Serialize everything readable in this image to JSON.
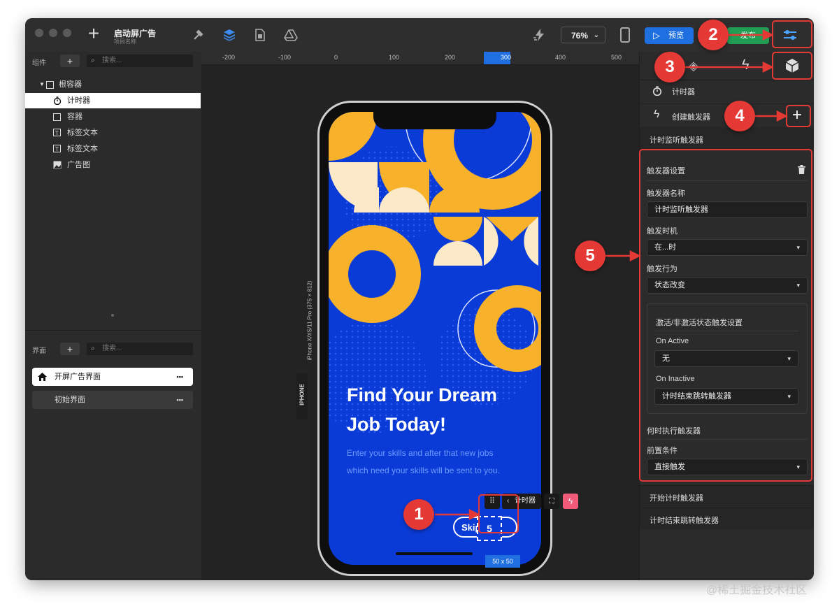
{
  "toolbar": {
    "project_title": "启动屏广告",
    "project_subtitle": "项目名称",
    "zoom": "76%",
    "preview_label": "预览",
    "publish_label": "发布"
  },
  "components_panel": {
    "header": "组件",
    "search_placeholder": "搜索...",
    "tree": [
      {
        "label": "根容器",
        "icon": "square-icon"
      },
      {
        "label": "计时器",
        "icon": "timer-icon"
      },
      {
        "label": "容器",
        "icon": "square-icon"
      },
      {
        "label": "标签文本",
        "icon": "text-icon"
      },
      {
        "label": "标签文本",
        "icon": "text-icon"
      },
      {
        "label": "广告图",
        "icon": "image-icon"
      }
    ]
  },
  "screens_panel": {
    "header": "界面",
    "search_placeholder": "搜索...",
    "screens": [
      {
        "label": "开屏广告界面",
        "more": "•••"
      },
      {
        "label": "初始界面",
        "more": "•••"
      }
    ]
  },
  "ruler": {
    "ticks": [
      "-200",
      "-100",
      "0",
      "100",
      "200",
      "300",
      "400",
      "500"
    ]
  },
  "device": {
    "vertical_label": "iPhone X/XS/11 Pro (375 × 812)",
    "tag": "IPHONE",
    "headline_1": "Find Your Dream",
    "headline_2": "Job Today!",
    "body_1": "Enter your skills and after that new jobs",
    "body_2": "which need your skills will be sent to you.",
    "skip": "Skip",
    "timer_value": "5",
    "timer_chip": "计时器",
    "size_label": "50 x 50",
    "ruler_highlight": "300"
  },
  "right_panel": {
    "timer_title": "计时器",
    "create_trigger": "创建触发器",
    "section_title": "计时监听触发器",
    "trigger_settings": "触发器设置",
    "name_label": "触发器名称",
    "name_value": "计时监听触发器",
    "timing_label": "触发时机",
    "timing_value": "在...时",
    "action_label": "触发行为",
    "action_value": "状态改变",
    "state_settings": "激活/非激活状态触发设置",
    "on_active_label": "On Active",
    "on_active_value": "无",
    "on_inactive_label": "On Inactive",
    "on_inactive_value": "计时结束跳转触发器",
    "when_label": "何时执行触发器",
    "precondition_label": "前置条件",
    "precondition_value": "直接触发",
    "other_triggers": [
      "开始计时触发器",
      "计时结束跳转触发器"
    ]
  },
  "annotations": [
    "1",
    "2",
    "3",
    "4",
    "5"
  ],
  "watermark": "@稀土掘金技术社区",
  "colors": {
    "accent_red": "#e53935",
    "phone_blue": "#0a3bd6",
    "shape_orange": "#f7b12a",
    "shape_cream": "#fbe9c7",
    "preview_blue": "#1f6fe0",
    "publish_green": "#1f9e54"
  }
}
